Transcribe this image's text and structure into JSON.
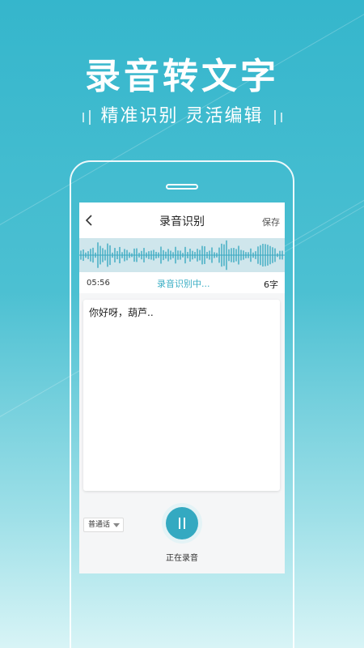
{
  "hero": {
    "title": "录音转文字",
    "subtitle": "精准识别 灵活编辑"
  },
  "screen": {
    "nav": {
      "title": "录音识别",
      "save_label": "保存",
      "back_icon": "chevron-left-icon"
    },
    "info": {
      "elapsed": "05:56",
      "status": "录音识别中...",
      "word_count": "6字"
    },
    "transcript": "你好呀，葫芦..",
    "language": {
      "selected": "普通话"
    },
    "record": {
      "label": "正在录音",
      "state": "pause-icon"
    }
  },
  "colors": {
    "accent": "#34a9c1",
    "waveform": "#3aa9c2",
    "background_top": "#35b6cc",
    "background_bottom": "#d8f4f6"
  }
}
